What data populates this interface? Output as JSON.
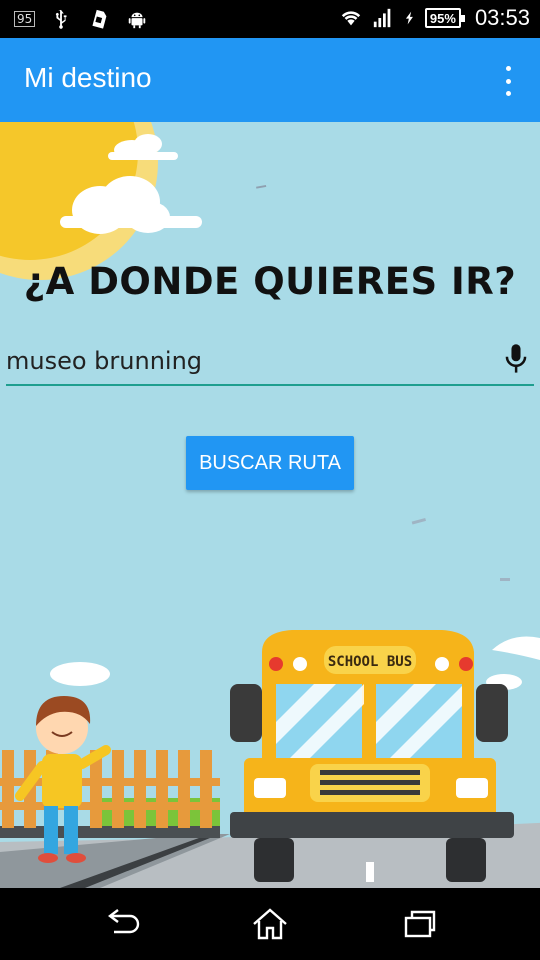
{
  "status_bar": {
    "notification_badge": "95",
    "battery": "95%",
    "time": "03:53",
    "icons": [
      "usb-icon",
      "sim-icon",
      "android-icon",
      "wifi-icon",
      "signal-icon",
      "charging-icon",
      "battery-icon"
    ]
  },
  "app_bar": {
    "title": "Mi destino",
    "menu_icon": "overflow-menu-icon",
    "color": "#2196f3"
  },
  "main": {
    "headline": "¿A DONDE QUIERES IR?",
    "destination_value": "museo brunning",
    "mic_icon": "microphone-icon",
    "search_button": "BUSCAR RUTA",
    "bus_label": "SCHOOL BUS",
    "background_color": "#a9dbe7",
    "accent_underline": "#1e9e8f"
  },
  "nav_bar": {
    "icons": [
      "back-icon",
      "home-icon",
      "recent-apps-icon"
    ]
  }
}
